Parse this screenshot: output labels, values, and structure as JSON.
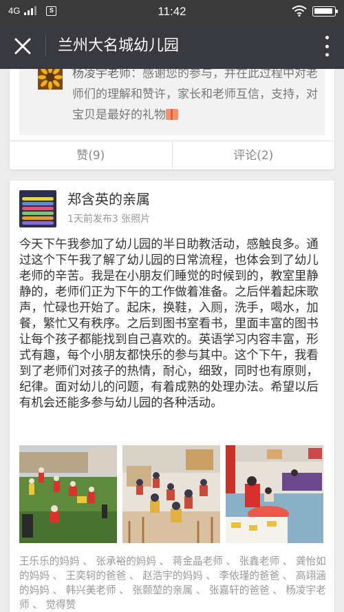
{
  "status_bar": {
    "network": "4G",
    "time": "11:42",
    "battery_level": 0.95
  },
  "titlebar": {
    "title": "兰州大名城幼儿园"
  },
  "previous_post": {
    "comment": {
      "author": "杨凌宇老师",
      "separator": "：",
      "text": "感谢您的参与，并在此过程中对老师们的理解和赞许，家长和老师互信，支持，对宝贝是最好的礼物"
    },
    "like_label": "赞(9)",
    "comment_label": "评论(2)"
  },
  "post": {
    "author": "郑含英的亲属",
    "meta": "1天前发布3 张照片",
    "body": "今天下午我参加了幼儿园的半日助教活动，感触良多。通过这个下午我了解了幼儿园的日常流程，也体会到了幼儿老师的辛苦。我是在小朋友们睡觉的时候到的，教室里静静的，老师们正为下午的工作做着准备。之后伴着起床歌声，忙碌也开始了。起床，换鞋，入厕，洗手，喝水，加餐，繁忙又有秩序。之后到图书室看书，里面丰富的图书让每个孩子都能找到自己喜欢的。英语学习内容丰富，形式有趣，每个小朋友都快乐的参与其中。这个下午，我看到了老师们对孩子的热情，耐心，细致，同时也有原则，纪律。面对幼儿的问题，有着成熟的处理办法。希望以后有机会还能多参与幼儿园的各种活动。",
    "likes": "王乐乐的妈妈 、 张承裕的妈妈 、 蒋金晶老师 、 张鑫老师 、 龚怡如的妈妈 、 王奕轲的爸爸 、 赵浩宇的妈妈 、 李依瑾的爸爸 、 高翊涵的妈妈 、 韩兴美老师 、 张颢堃的亲属 、 张嘉轩的爸爸 、 杨凌宇老师 、 觉得赞"
  }
}
